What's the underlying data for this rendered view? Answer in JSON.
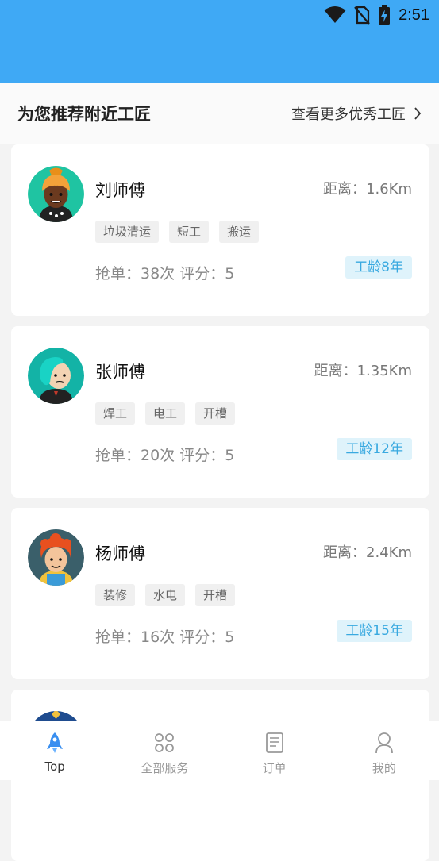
{
  "status_bar": {
    "time": "2:51",
    "bg_color": "#3fa9f5"
  },
  "header": {
    "title": "为您推荐附近工匠",
    "more_label": "查看更多优秀工匠"
  },
  "workers": [
    {
      "name": "刘师傅",
      "distance": "距离：1.6Km",
      "tags": [
        "垃圾清运",
        "短工",
        "搬运"
      ],
      "stats": "抢单：38次 评分：5",
      "seniority": "工龄8年",
      "avatar_icon": "avatar-woman-headwrap-icon"
    },
    {
      "name": "张师傅",
      "distance": "距离：1.35Km",
      "tags": [
        "焊工",
        "电工",
        "开槽"
      ],
      "stats": "抢单：20次 评分：5",
      "seniority": "工龄12年",
      "avatar_icon": "avatar-man-cyan-hair-icon"
    },
    {
      "name": "杨师傅",
      "distance": "距离：2.4Km",
      "tags": [
        "装修",
        "水电",
        "开槽"
      ],
      "stats": "抢单：16次 评分：5",
      "seniority": "工龄15年",
      "avatar_icon": "avatar-man-red-curly-hair-icon"
    }
  ],
  "nav": [
    {
      "label": "Top",
      "icon": "rocket-icon",
      "active": true
    },
    {
      "label": "全部服务",
      "icon": "grid-icon",
      "active": false
    },
    {
      "label": "订单",
      "icon": "document-icon",
      "active": false
    },
    {
      "label": "我的",
      "icon": "person-icon",
      "active": false
    }
  ]
}
